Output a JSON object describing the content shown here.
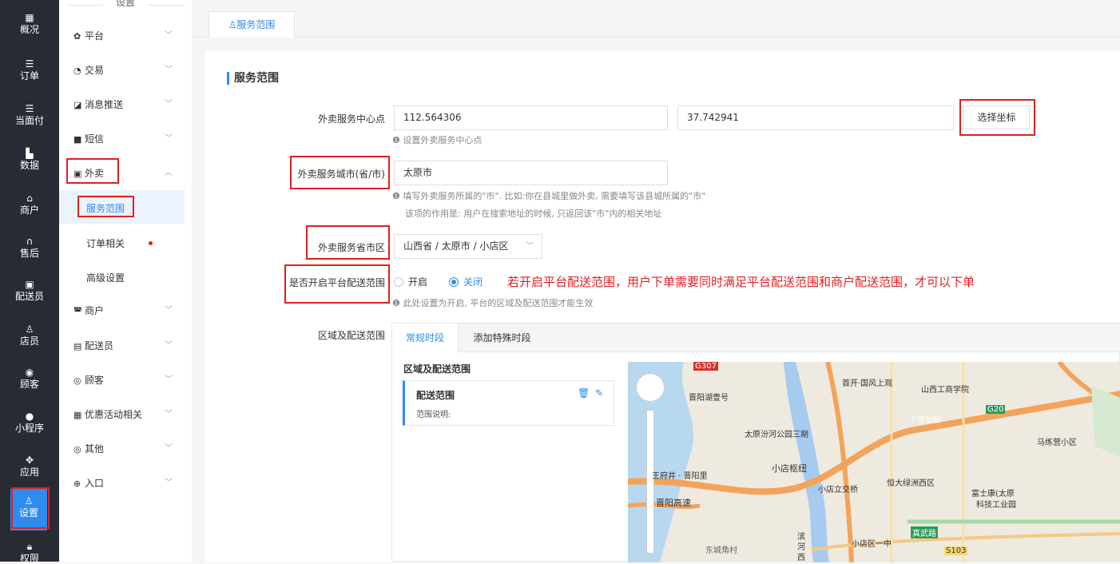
{
  "leftbar": {
    "items": [
      {
        "label": "概况",
        "icon": "dashboard-icon"
      },
      {
        "label": "订单",
        "icon": "list-icon"
      },
      {
        "label": "当面付",
        "icon": "list-icon"
      },
      {
        "label": "数据",
        "icon": "bar-chart-icon"
      },
      {
        "label": "商户",
        "icon": "store-icon"
      },
      {
        "label": "售后",
        "icon": "headset-icon"
      },
      {
        "label": "配送员",
        "icon": "delivery-icon"
      },
      {
        "label": "店员",
        "icon": "staff-icon"
      },
      {
        "label": "顾客",
        "icon": "customer-icon"
      },
      {
        "label": "小程序",
        "icon": "wechat-icon"
      },
      {
        "label": "应用",
        "icon": "apps-icon"
      },
      {
        "label": "设置",
        "icon": "settings-icon"
      },
      {
        "label": "权限",
        "icon": "lock-icon"
      }
    ],
    "active": "设置"
  },
  "sidebar": {
    "title": "设置",
    "items": [
      {
        "label": "平台",
        "icon": "gear-icon"
      },
      {
        "label": "交易",
        "icon": "trade-icon"
      },
      {
        "label": "消息推送",
        "icon": "message-icon"
      },
      {
        "label": "短信",
        "icon": "sms-icon"
      },
      {
        "label": "外卖",
        "icon": "takeout-icon"
      },
      {
        "label": "商户",
        "icon": "store-icon"
      },
      {
        "label": "配送员",
        "icon": "delivery-icon"
      },
      {
        "label": "顾客",
        "icon": "customer-icon"
      },
      {
        "label": "优惠活动相关",
        "icon": "gift-icon"
      },
      {
        "label": "其他",
        "icon": "other-icon"
      },
      {
        "label": "入口",
        "icon": "entry-icon"
      }
    ],
    "subitems": [
      {
        "label": "服务范围"
      },
      {
        "label": "订单相关"
      },
      {
        "label": "高级设置"
      }
    ]
  },
  "topbar": {
    "tab_label": "服务范围",
    "tab_icon": "person-pin-icon"
  },
  "form": {
    "section_title": "服务范围",
    "center_label": "外卖服务中心点",
    "longitude": "112.564306",
    "latitude": "37.742941",
    "select_coord_button": "选择坐标",
    "center_help": "设置外卖服务中心点",
    "city_label": "外卖服务城市(省/市)",
    "city_value": "太原市",
    "city_help_1": "填写外卖服务所属的\"市\". 比如:你在县城里做外卖, 需要填写该县城所属的\"市\"",
    "city_help_2": "该项的作用是: 用户在搜索地址的时候, 只返回该\"市\"内的相关地址",
    "region_label": "外卖服务省市区",
    "region_value": "山西省 / 太原市 / 小店区",
    "platform_range_label": "是否开启平台配送范围",
    "radio_on": "开启",
    "radio_off": "关闭",
    "platform_range_selected": "关闭",
    "annotation": "若开启平台配送范围，用户下单需要同时满足平台配送范围和商户配送范围，才可以下单",
    "platform_range_help": "此处设置为开启, 平台的区域及配送范围才能生效",
    "area_label": "区域及配送范围"
  },
  "area_card": {
    "tabs": [
      "常规时段",
      "添加特殊时段"
    ],
    "active_tab": "常规时段",
    "list_title": "区域及配送范围",
    "range_item": {
      "title": "配送范围",
      "desc": "范围说明:"
    }
  },
  "map": {
    "labels": [
      "G307",
      "晋阳湖壹号",
      "首开·国风上观",
      "山西工商学院",
      "十里长桥",
      "G20",
      "马练营小区",
      "太原汾河公园三期",
      "小店枢纽",
      "王府井 · 晋阳里",
      "恒大绿洲西区",
      "富士康(太原",
      "科技工业园",
      "晋阳高速",
      "小店立交桥",
      "滨",
      "河",
      "西",
      "东城角村",
      "小店区一中",
      "真武路",
      "S103"
    ]
  },
  "colors": {
    "accent": "#2d8cf0",
    "annotation": "#e02020",
    "leftbar": "#282b33"
  }
}
